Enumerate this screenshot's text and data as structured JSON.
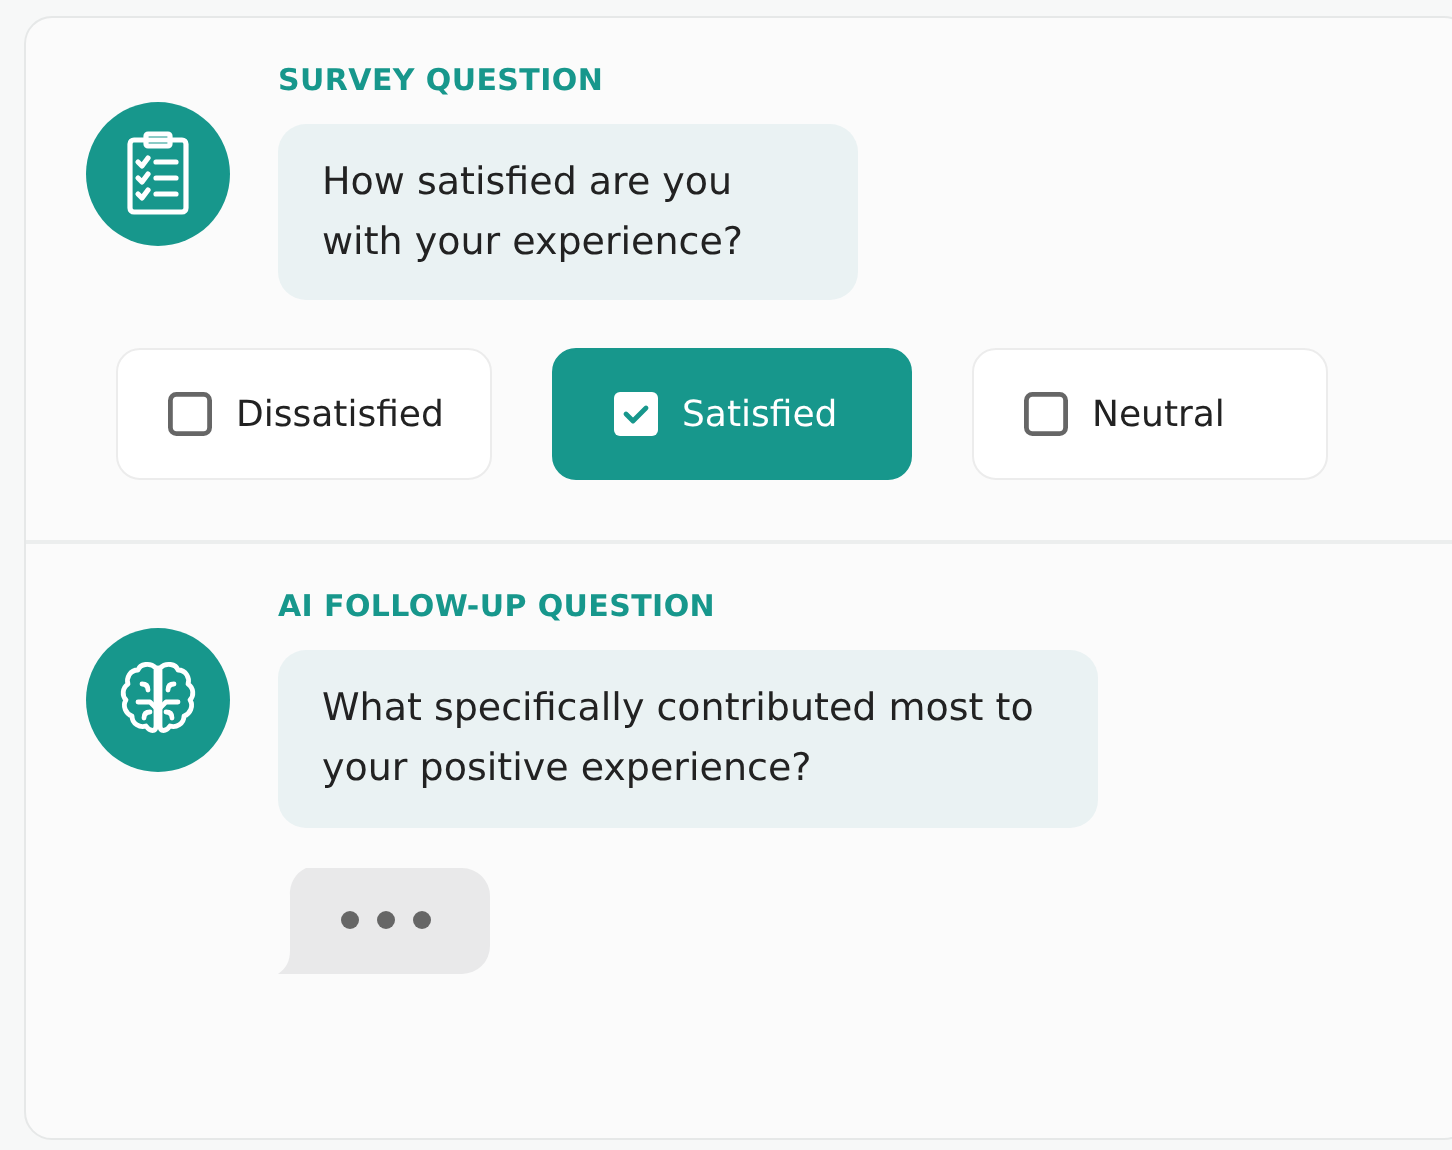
{
  "sections": [
    {
      "kind": "survey",
      "label": "SURVEY QUESTION",
      "question": "How satisfied are you with your experience?",
      "options": [
        {
          "label": "Dissatisfied",
          "selected": false
        },
        {
          "label": "Satisfied",
          "selected": true
        },
        {
          "label": "Neutral",
          "selected": false
        }
      ]
    },
    {
      "kind": "followup",
      "label": "AI FOLLOW-UP QUESTION",
      "question": "What specifically contributed most to your positive experience?",
      "typing": true
    }
  ]
}
